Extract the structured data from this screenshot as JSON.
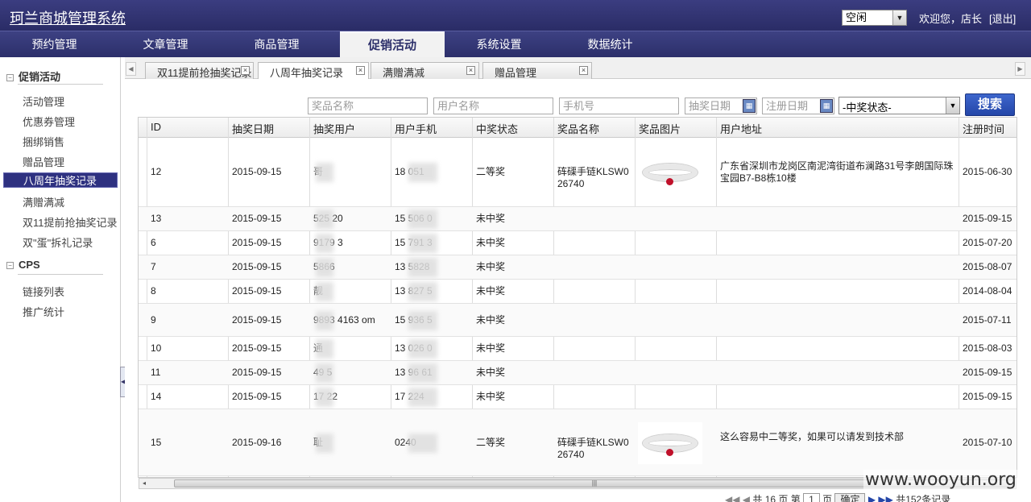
{
  "header": {
    "app_title": "珂兰商城管理系统",
    "status_value": "空闲",
    "welcome": "欢迎您，店长",
    "logout": "[退出]"
  },
  "nav": {
    "items": [
      {
        "label": "预约管理"
      },
      {
        "label": "文章管理"
      },
      {
        "label": "商品管理"
      },
      {
        "label": "促销活动",
        "active": true
      },
      {
        "label": "系统设置"
      },
      {
        "label": "数据统计"
      }
    ]
  },
  "sidebar": {
    "groups": [
      {
        "title": "促销活动",
        "items": [
          "活动管理",
          "优惠券管理",
          "捆绑销售",
          "赠品管理",
          "八周年抽奖记录",
          "满赠满减",
          "双11提前抢抽奖记录",
          "双\"蛋\"拆礼记录"
        ]
      },
      {
        "title": "CPS",
        "items": [
          "链接列表",
          "推广统计"
        ]
      }
    ],
    "active_item": "八周年抽奖记录"
  },
  "tabs": [
    {
      "label": "双11提前抢抽奖记录"
    },
    {
      "label": "八周年抽奖记录",
      "active": true
    },
    {
      "label": "满赠满减"
    },
    {
      "label": "赠品管理"
    }
  ],
  "filters": {
    "prize_name_ph": "奖品名称",
    "user_name_ph": "用户名称",
    "phone_ph": "手机号",
    "draw_date_ph": "抽奖日期",
    "reg_date_ph": "注册日期",
    "win_status": "-中奖状态-",
    "search_label": "搜索"
  },
  "table": {
    "columns": [
      "ID",
      "抽奖日期",
      "抽奖用户",
      "用户手机",
      "中奖状态",
      "奖品名称",
      "奖品图片",
      "用户地址",
      "注册时间"
    ],
    "rows": [
      {
        "id": "12",
        "date": "2015-09-15",
        "user": "哥",
        "phone": "18 051",
        "status": "二等奖",
        "prize": "砗磲手链KLSW026740",
        "has_img": true,
        "address": "广东省深圳市龙岗区南泥湾街道布澜路31号李朗国际珠宝园B7-B8栋10楼",
        "reg": "2015-06-30"
      },
      {
        "id": "13",
        "date": "2015-09-15",
        "user": "525 20",
        "phone": "15 506 0",
        "status": "未中奖",
        "prize": "",
        "has_img": false,
        "address": "",
        "reg": "2015-09-15"
      },
      {
        "id": "6",
        "date": "2015-09-15",
        "user": "9179 3",
        "phone": "15 791 3",
        "status": "未中奖",
        "prize": "",
        "has_img": false,
        "address": "",
        "reg": "2015-07-20"
      },
      {
        "id": "7",
        "date": "2015-09-15",
        "user": "5866",
        "phone": "13 5828",
        "status": "未中奖",
        "prize": "",
        "has_img": false,
        "address": "",
        "reg": "2015-08-07"
      },
      {
        "id": "8",
        "date": "2015-09-15",
        "user": "靓",
        "phone": "13 827 5",
        "status": "未中奖",
        "prize": "",
        "has_img": false,
        "address": "",
        "reg": "2014-08-04"
      },
      {
        "id": "9",
        "date": "2015-09-15",
        "user": "9893 4163 om",
        "phone": "15 936 5",
        "status": "未中奖",
        "prize": "",
        "has_img": false,
        "address": "",
        "reg": "2015-07-11"
      },
      {
        "id": "10",
        "date": "2015-09-15",
        "user": "通",
        "phone": "13 026 0",
        "status": "未中奖",
        "prize": "",
        "has_img": false,
        "address": "",
        "reg": "2015-08-03"
      },
      {
        "id": "11",
        "date": "2015-09-15",
        "user": "49 5",
        "phone": "13 96 61",
        "status": "未中奖",
        "prize": "",
        "has_img": false,
        "address": "",
        "reg": "2015-09-15"
      },
      {
        "id": "14",
        "date": "2015-09-15",
        "user": "17 22",
        "phone": "17 224",
        "status": "未中奖",
        "prize": "",
        "has_img": false,
        "address": "",
        "reg": "2015-09-15"
      },
      {
        "id": "15",
        "date": "2015-09-16",
        "user": "耻",
        "phone": "0240",
        "status": "二等奖",
        "prize": "砗磲手链KLSW026740",
        "has_img": true,
        "address": "这么容易中二等奖，如果可以请发到技术部",
        "reg": "2015-07-10"
      }
    ]
  },
  "pager": {
    "text": "共 16 页 第",
    "page": "1",
    "page_suffix": "页",
    "go_label": "确定",
    "total": "共152条记录"
  },
  "watermark": "www.wooyun.org",
  "colors": {
    "header_bg": "#2c2f6a",
    "active_side": "#2e3180",
    "search_btn": "#2e55bb"
  }
}
